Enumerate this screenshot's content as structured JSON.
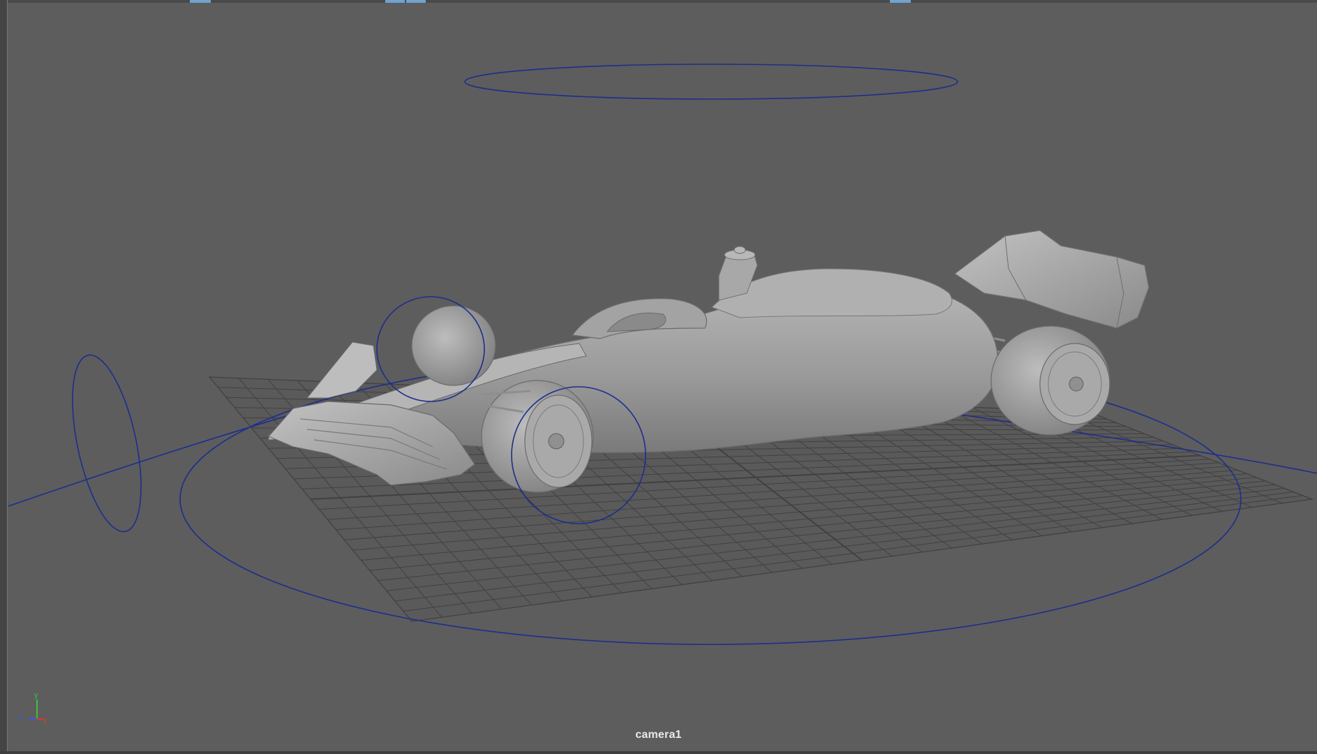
{
  "viewport": {
    "camera_name": "camera1"
  },
  "axis_gizmo": {
    "x_label": "x",
    "y_label": "y",
    "z_label": "z",
    "x_color": "#d63a2a",
    "y_color": "#3fbf3f",
    "z_color": "#3a5bd6"
  },
  "colors": {
    "background": "#5d5d5d",
    "grid": "#3f3f3f",
    "curve": "#1e2f8a",
    "model": "#9c9c9c",
    "model_shade": "#7e7e7e",
    "model_highlight": "#b8b8b8"
  },
  "scene": {
    "model": "formula-car",
    "grid": "ground-grid",
    "control_curves": [
      "top-halo-ring",
      "root-ring",
      "front-left-wheel-ring",
      "front-right-wheel-ring",
      "side-ring",
      "direction-line"
    ]
  }
}
